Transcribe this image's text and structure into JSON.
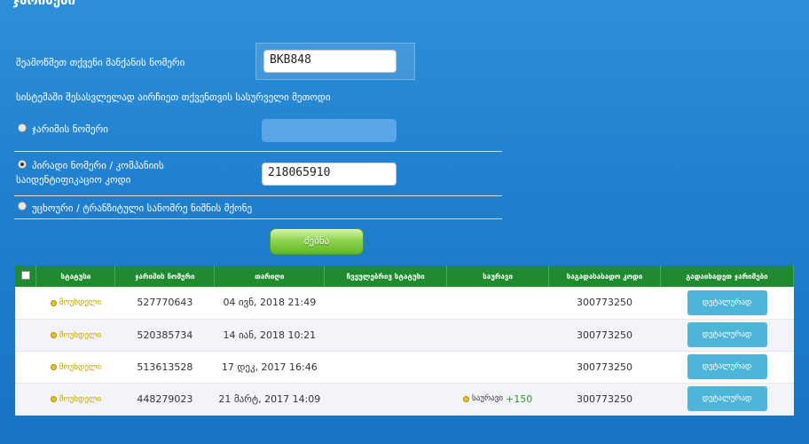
{
  "header": {
    "title": "ჯარიმები"
  },
  "form": {
    "plate_label": "შეამოწმეთ თქვენი მანქანის ნომერი",
    "plate_value": "BKB848",
    "method_label": "სისტემაში შესასვლელად აირჩიეთ თქვენთვის სასურველი მეთოდი",
    "options": [
      {
        "label": "ჯარიმის ნომერი",
        "checked": false,
        "value": ""
      },
      {
        "label_line1": "პირადი ნომერი / კომპანიის",
        "label_line2": "საიდენტიფიკაციო კოდი",
        "checked": true,
        "value": "218065910"
      },
      {
        "label": "უცხოური / ტრანზიტული სანომრე ნიშნის მქონე",
        "checked": false
      }
    ],
    "search_label": "ძებნა"
  },
  "table": {
    "headers": [
      "სტატუსი",
      "ჯარიმის ნომერი",
      "თარიღი",
      "ჩვეულებრივ სტატუსი",
      "საურავი",
      "საგადასახადო კოდი",
      "გადაიხადეთ ჯარიმები"
    ],
    "rows": [
      {
        "status": "მოუხდელი",
        "fine_no": "527770643",
        "date": "04 ივნ, 2018 21:49",
        "surcharge_label": "",
        "surcharge_amount": "",
        "tax_code": "300773250",
        "action": "დეტალურად"
      },
      {
        "status": "მოუხდელი",
        "fine_no": "520385734",
        "date": "14 იან, 2018 10:21",
        "surcharge_label": "",
        "surcharge_amount": "",
        "tax_code": "300773250",
        "action": "დეტალურად"
      },
      {
        "status": "მოუხდელი",
        "fine_no": "513613528",
        "date": "17 დეკ, 2017 16:46",
        "surcharge_label": "",
        "surcharge_amount": "",
        "tax_code": "300773250",
        "action": "დეტალურად"
      },
      {
        "status": "მოუხდელი",
        "fine_no": "448279023",
        "date": "21 მარტ, 2017 14:09",
        "surcharge_label": "საურავი",
        "surcharge_amount": "+150",
        "tax_code": "300773250",
        "action": "დეტალურად"
      }
    ]
  },
  "colors": {
    "background": "#2d8fd8",
    "table_header": "#1f8a2e",
    "status": "#c9a000",
    "detail_button": "#4db5d8",
    "search_button": "#8fd44f"
  }
}
